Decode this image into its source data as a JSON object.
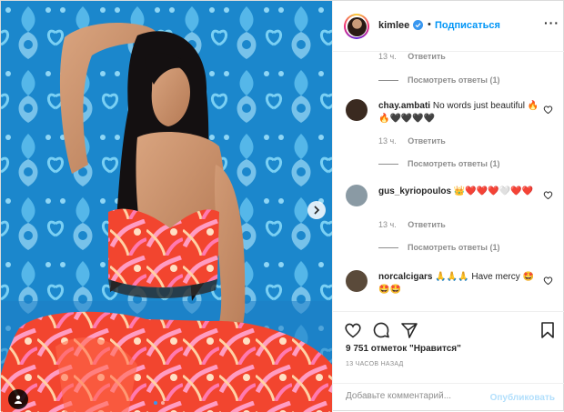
{
  "header": {
    "username": "kimlee",
    "separator": "•",
    "follow_label": "Подписаться",
    "more_label": "···"
  },
  "comments": {
    "top_meta": {
      "time": "13 ч.",
      "reply": "Ответить"
    },
    "view_replies_1": "Посмотреть ответы (1)",
    "items": [
      {
        "username": "chay.ambati",
        "text": "No words just beautiful",
        "emoji": "🔥🔥🖤🖤🖤🖤",
        "time": "13 ч.",
        "reply": "Ответить",
        "view_replies": "Посмотреть ответы (1)",
        "avatar_color": "#3a2a20"
      },
      {
        "username": "gus_kyriopoulos",
        "text": "",
        "emoji": "👑❤️❤️❤️🤍❤️❤️",
        "time": "13 ч.",
        "reply": "Ответить",
        "view_replies": "Посмотреть ответы (1)",
        "avatar_color": "#8a9aa4"
      },
      {
        "username": "norcalcigars",
        "text": "🙏🙏🙏 Have mercy",
        "emoji": "🤩🤩🤩",
        "avatar_color": "#5a4a3a"
      }
    ]
  },
  "likes_text": "9 751 отметок \"Нравится\"",
  "posted_time": "13 ЧАСОВ НАЗАД",
  "add_comment": {
    "placeholder": "Добавьте комментарий...",
    "publish_label": "Опубликовать"
  },
  "colors": {
    "accent": "#0095f6",
    "publish_disabled": "#b2dffc",
    "muted": "#8e8e8e",
    "photo_background": "#1a86c9"
  },
  "icons": {
    "like": "heart-icon",
    "comment": "speech-bubble-icon",
    "share": "paper-plane-icon",
    "save": "bookmark-icon",
    "verified": "verified-badge-icon",
    "next": "chevron-right-icon",
    "tagged": "user-tag-icon"
  },
  "carousel": {
    "slide_count": 2,
    "active_slide": 1
  }
}
